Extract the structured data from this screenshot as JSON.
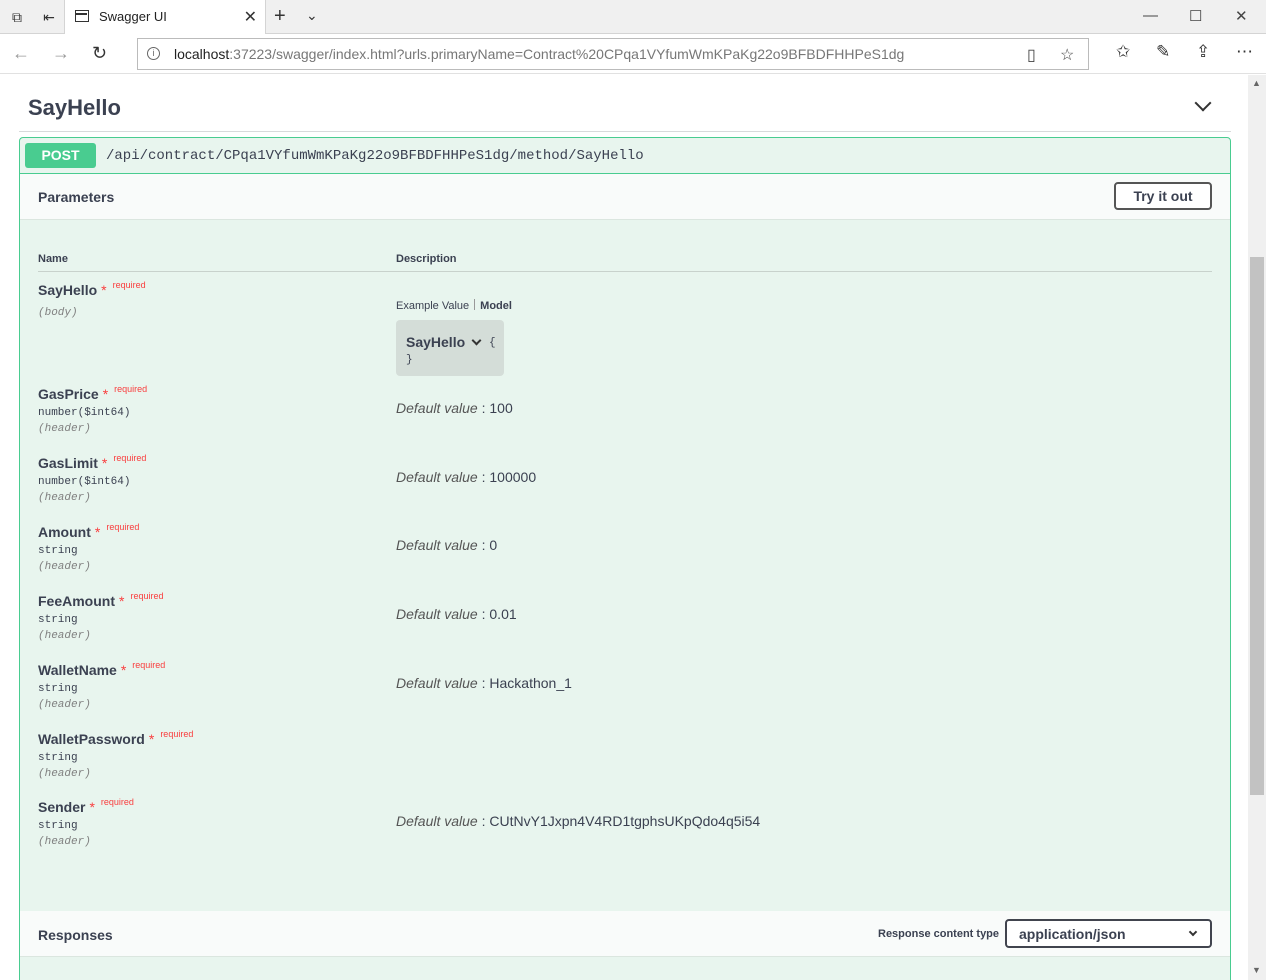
{
  "browser": {
    "tab_title": "Swagger UI",
    "url_host": "localhost",
    "url_rest": ":37223/swagger/index.html?urls.primaryName=Contract%20CPqa1VYfumWmKPaKg22o9BFBDFHHPeS1dg"
  },
  "section": {
    "title": "SayHello"
  },
  "operation": {
    "method": "POST",
    "path": "/api/contract/CPqa1VYfumWmKPaKg22o9BFBDFHHPeS1dg/method/SayHello",
    "parameters_label": "Parameters",
    "try_label": "Try it out",
    "col_name": "Name",
    "col_desc": "Description",
    "required_label": "required",
    "default_label": "Default value",
    "example_tab": "Example Value",
    "model_tab": "Model",
    "model_name": "SayHello",
    "model_open": "{",
    "model_close": "}",
    "params": [
      {
        "name": "SayHello",
        "type": "",
        "in": "(body)",
        "default": ""
      },
      {
        "name": "GasPrice",
        "type": "number($int64)",
        "in": "(header)",
        "default": "100"
      },
      {
        "name": "GasLimit",
        "type": "number($int64)",
        "in": "(header)",
        "default": "100000"
      },
      {
        "name": "Amount",
        "type": "string",
        "in": "(header)",
        "default": "0"
      },
      {
        "name": "FeeAmount",
        "type": "string",
        "in": "(header)",
        "default": "0.01"
      },
      {
        "name": "WalletName",
        "type": "string",
        "in": "(header)",
        "default": "Hackathon_1"
      },
      {
        "name": "WalletPassword",
        "type": "string",
        "in": "(header)",
        "default": ""
      },
      {
        "name": "Sender",
        "type": "string",
        "in": "(header)",
        "default": "CUtNvY1Jxpn4V4RD1tgphsUKpQdo4q5i54"
      }
    ],
    "responses_label": "Responses",
    "response_content_type_label": "Response content type",
    "response_content_type": "application/json"
  },
  "colors": {
    "post": "#49cc90",
    "post_bg": "#e8f5ee",
    "required": "#f93e3e"
  }
}
